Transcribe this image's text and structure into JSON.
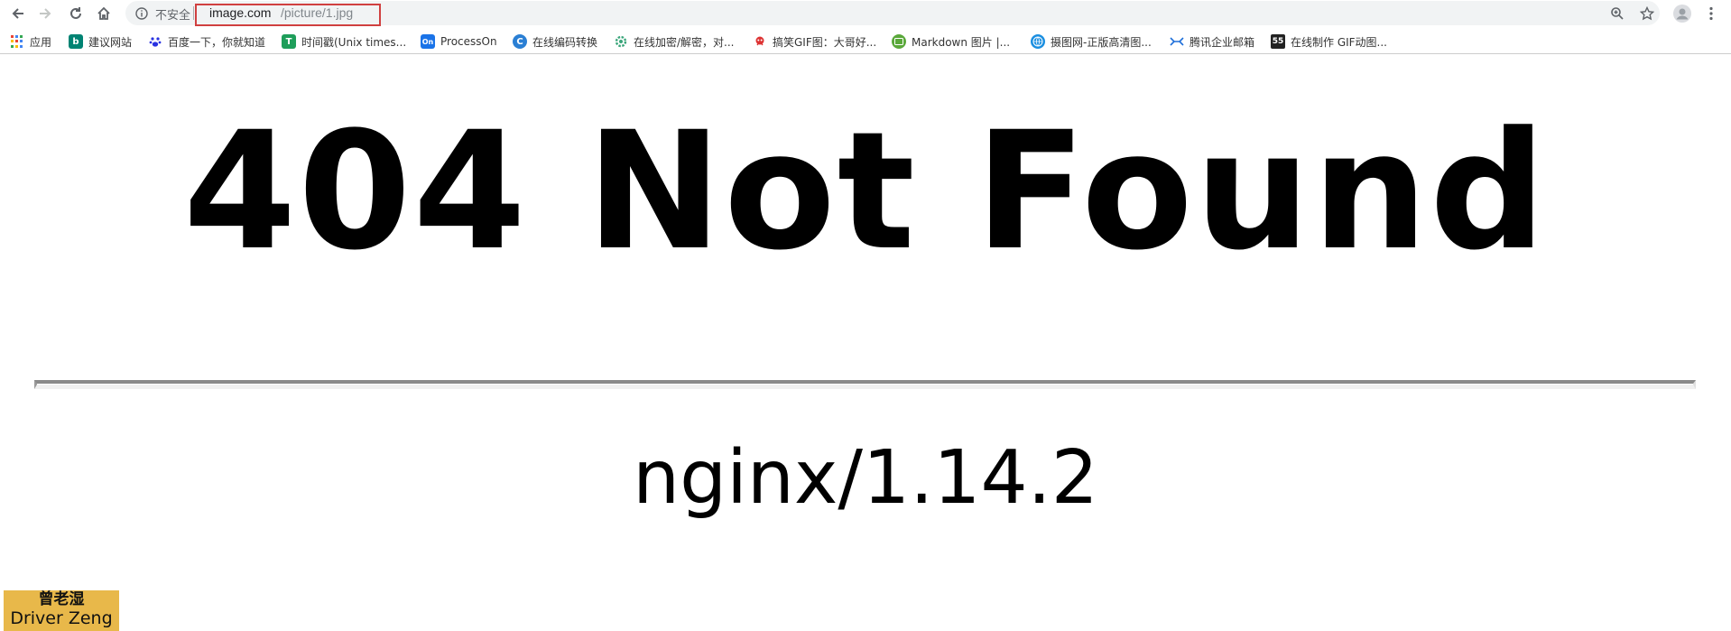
{
  "toolbar": {
    "back_icon": "arrow-back-icon",
    "forward_icon": "arrow-forward-icon",
    "reload_icon": "reload-icon",
    "home_icon": "home-icon",
    "security_label": "不安全",
    "url_host": "image.com",
    "url_path": "/picture/1.jpg",
    "zoom_icon": "zoom-icon",
    "bookmark_star_icon": "star-icon",
    "profile_icon": "avatar-icon",
    "menu_icon": "kebab-menu-icon",
    "highlight_color": "#d04040"
  },
  "bookmarks": {
    "items": [
      {
        "label": "应用",
        "icon": "apps-grid-icon"
      },
      {
        "label": "建议网站",
        "icon": "bing-icon"
      },
      {
        "label": "百度一下，你就知道",
        "icon": "baidu-paw-icon"
      },
      {
        "label": "时间戳(Unix times...",
        "icon": "timestamp-icon"
      },
      {
        "label": "ProcessOn",
        "icon": "processon-icon"
      },
      {
        "label": "在线编码转换",
        "icon": "encoding-icon"
      },
      {
        "label": "在线加密/解密，对...",
        "icon": "gear-icon"
      },
      {
        "label": "搞笑GIF图：大哥好...",
        "icon": "gif-icon"
      },
      {
        "label": "Markdown 图片 |...",
        "icon": "markdown-icon"
      },
      {
        "label": "摄图网-正版高清图...",
        "icon": "globe-icon"
      },
      {
        "label": "腾讯企业邮箱",
        "icon": "tencent-mail-icon"
      },
      {
        "label": "在线制作 GIF动图...",
        "icon": "gif55-icon"
      }
    ]
  },
  "page": {
    "heading": "404 Not Found",
    "server": "nginx/1.14.2"
  },
  "watermark": {
    "line1": "曾老湿",
    "line2": "Driver Zeng",
    "background_color": "#e8b84a"
  }
}
